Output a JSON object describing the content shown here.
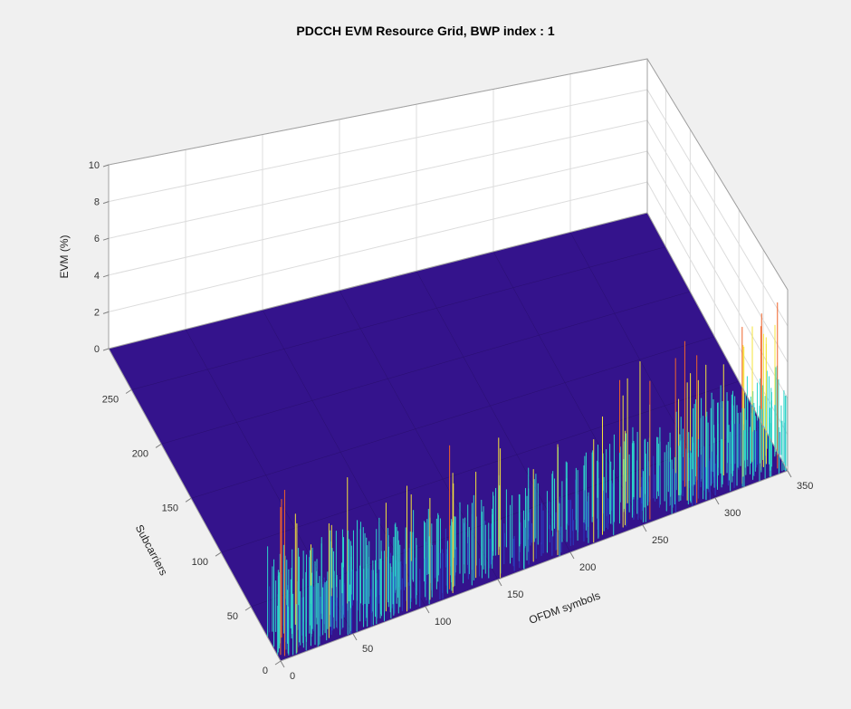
{
  "title": "PDCCH EVM Resource Grid, BWP index : 1",
  "axes": {
    "x": {
      "label": "OFDM symbols",
      "min": 0,
      "max": 350,
      "ticks": [
        0,
        50,
        100,
        150,
        200,
        250,
        300,
        350
      ]
    },
    "y": {
      "label": "Subcarriers",
      "min": 0,
      "max": 288,
      "ticks": [
        0,
        50,
        100,
        150,
        200,
        250
      ]
    },
    "z": {
      "label": "EVM (%)",
      "min": 0,
      "max": 10,
      "ticks": [
        0,
        2,
        4,
        6,
        8,
        10
      ]
    }
  },
  "chart_data": {
    "type": "heatmap",
    "title": "PDCCH EVM Resource Grid, BWP index : 1",
    "xlabel": "OFDM symbols",
    "ylabel": "Subcarriers",
    "zlabel": "EVM (%)",
    "xlim": [
      0,
      350
    ],
    "ylim": [
      0,
      288
    ],
    "zlim": [
      0,
      10
    ],
    "description": "3D surface/stem plot of EVM (%) over an OFDM resource grid. Over most of the subcarrier range the surface is essentially zero (floor). A dense band of narrow spikes is concentrated at the lowest subcarrier rows (approx. subcarriers 0–30), spread across the full OFDM-symbol span 0–350. Typical spike heights are in the 1–5 % range with occasional peaks reaching roughly 7–9 %. Spike activity is strongest near OFDM symbols 0–40 and again toward 250–350.",
    "sample_peaks": [
      {
        "ofdm": 2,
        "subcarrier": 5,
        "evm": 8.0
      },
      {
        "ofdm": 4,
        "subcarrier": 3,
        "evm": 9.0
      },
      {
        "ofdm": 8,
        "subcarrier": 18,
        "evm": 7.5
      },
      {
        "ofdm": 12,
        "subcarrier": 2,
        "evm": 7.0
      },
      {
        "ofdm": 20,
        "subcarrier": 24,
        "evm": 6.0
      },
      {
        "ofdm": 25,
        "subcarrier": 10,
        "evm": 5.0
      },
      {
        "ofdm": 35,
        "subcarrier": 4,
        "evm": 6.2
      },
      {
        "ofdm": 40,
        "subcarrier": 12,
        "evm": 5.5
      },
      {
        "ofdm": 50,
        "subcarrier": 3,
        "evm": 4.0
      },
      {
        "ofdm": 58,
        "subcarrier": 8,
        "evm": 3.0
      },
      {
        "ofdm": 65,
        "subcarrier": 20,
        "evm": 4.2
      },
      {
        "ofdm": 72,
        "subcarrier": 6,
        "evm": 3.5
      },
      {
        "ofdm": 80,
        "subcarrier": 15,
        "evm": 4.0
      },
      {
        "ofdm": 88,
        "subcarrier": 2,
        "evm": 6.8
      },
      {
        "ofdm": 95,
        "subcarrier": 22,
        "evm": 3.2
      },
      {
        "ofdm": 105,
        "subcarrier": 5,
        "evm": 4.4
      },
      {
        "ofdm": 112,
        "subcarrier": 11,
        "evm": 3.8
      },
      {
        "ofdm": 120,
        "subcarrier": 3,
        "evm": 6.5
      },
      {
        "ofdm": 128,
        "subcarrier": 19,
        "evm": 3.0
      },
      {
        "ofdm": 136,
        "subcarrier": 7,
        "evm": 4.6
      },
      {
        "ofdm": 145,
        "subcarrier": 13,
        "evm": 3.4
      },
      {
        "ofdm": 152,
        "subcarrier": 1,
        "evm": 7.0
      },
      {
        "ofdm": 160,
        "subcarrier": 25,
        "evm": 4.0
      },
      {
        "ofdm": 168,
        "subcarrier": 9,
        "evm": 3.6
      },
      {
        "ofdm": 176,
        "subcarrier": 4,
        "evm": 5.0
      },
      {
        "ofdm": 184,
        "subcarrier": 17,
        "evm": 3.3
      },
      {
        "ofdm": 192,
        "subcarrier": 2,
        "evm": 6.0
      },
      {
        "ofdm": 200,
        "subcarrier": 23,
        "evm": 4.5
      },
      {
        "ofdm": 208,
        "subcarrier": 8,
        "evm": 3.8
      },
      {
        "ofdm": 216,
        "subcarrier": 14,
        "evm": 4.2
      },
      {
        "ofdm": 224,
        "subcarrier": 5,
        "evm": 6.4
      },
      {
        "ofdm": 232,
        "subcarrier": 20,
        "evm": 3.6
      },
      {
        "ofdm": 240,
        "subcarrier": 6,
        "evm": 5.1
      },
      {
        "ofdm": 248,
        "subcarrier": 12,
        "evm": 4.0
      },
      {
        "ofdm": 256,
        "subcarrier": 3,
        "evm": 7.5
      },
      {
        "ofdm": 264,
        "subcarrier": 26,
        "evm": 4.8
      },
      {
        "ofdm": 272,
        "subcarrier": 9,
        "evm": 3.9
      },
      {
        "ofdm": 280,
        "subcarrier": 15,
        "evm": 5.2
      },
      {
        "ofdm": 288,
        "subcarrier": 2,
        "evm": 8.0
      },
      {
        "ofdm": 296,
        "subcarrier": 22,
        "evm": 5.4
      },
      {
        "ofdm": 304,
        "subcarrier": 7,
        "evm": 4.7
      },
      {
        "ofdm": 312,
        "subcarrier": 18,
        "evm": 6.0
      },
      {
        "ofdm": 320,
        "subcarrier": 4,
        "evm": 8.5
      },
      {
        "ofdm": 328,
        "subcarrier": 24,
        "evm": 6.2
      },
      {
        "ofdm": 335,
        "subcarrier": 10,
        "evm": 7.8
      },
      {
        "ofdm": 340,
        "subcarrier": 14,
        "evm": 6.5
      },
      {
        "ofdm": 345,
        "subcarrier": 6,
        "evm": 9.0
      },
      {
        "ofdm": 348,
        "subcarrier": 20,
        "evm": 7.0
      }
    ],
    "spike_band_subcarriers": [
      0,
      30
    ],
    "approx_background_evm": 0
  },
  "colors": {
    "floor": "#34138c",
    "spike_low": "#2b3fbf",
    "spike_mid": "#2dd3c9",
    "spike_high": "#f6e33a",
    "spike_peak": "#f0632a"
  }
}
